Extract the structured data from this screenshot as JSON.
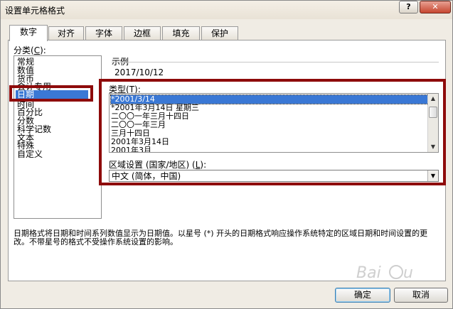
{
  "window": {
    "title": "设置单元格格式",
    "help_label": "?",
    "close_label": "✕"
  },
  "tabs": [
    {
      "label": "数字",
      "active": true
    },
    {
      "label": "对齐"
    },
    {
      "label": "字体"
    },
    {
      "label": "边框"
    },
    {
      "label": "填充"
    },
    {
      "label": "保护"
    }
  ],
  "category": {
    "label": "分类",
    "accel_open": "(",
    "accel": "C",
    "accel_close": "):",
    "items": [
      "常规",
      "数值",
      "货币",
      "会计专用",
      "日期",
      "时间",
      "百分比",
      "分数",
      "科学记数",
      "文本",
      "特殊",
      "自定义"
    ],
    "selected": "日期"
  },
  "sample": {
    "label": "示例",
    "value": "2017/10/12"
  },
  "type": {
    "label": "类型",
    "accel_open": "(",
    "accel": "T",
    "accel_close": "):",
    "items": [
      "*2001/3/14",
      "*2001年3月14日 星期三",
      "二〇〇一年三月十四日",
      "二〇〇一年三月",
      "三月十四日",
      "2001年3月14日",
      "2001年3月"
    ],
    "selected": "*2001/3/14"
  },
  "locale": {
    "label": "区域设置 (国家/地区)",
    "accel_open": " (",
    "accel": "L",
    "accel_close": "):",
    "value": "中文 (简体，中国)"
  },
  "description": "日期格式将日期和时间系列数值显示为日期值。以星号 (*) 开头的日期格式响应操作系统特定的区域日期和时间设置的更改。不带星号的格式不受操作系统设置的影响。",
  "buttons": {
    "ok": "确定",
    "cancel": "取消"
  },
  "colors": {
    "highlight": "#8e0b0b",
    "selection": "#3a78d5"
  },
  "icons": {
    "scroll_up": "up-arrow-icon",
    "scroll_down": "down-arrow-icon",
    "dropdown": "chevron-down-icon"
  }
}
